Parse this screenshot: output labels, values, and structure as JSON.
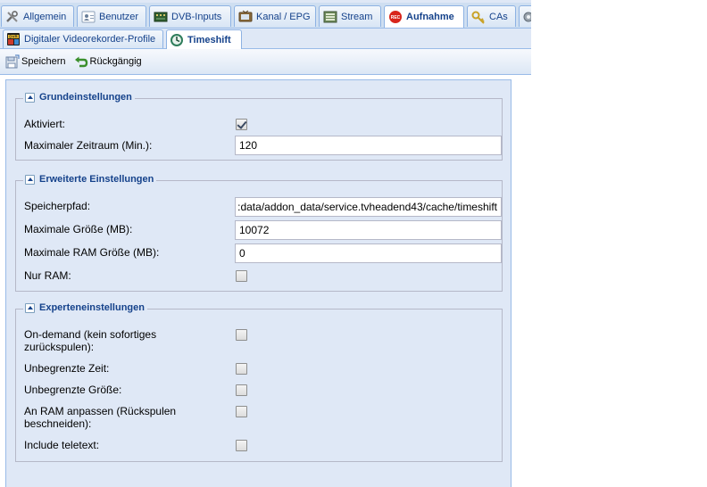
{
  "tabs": [
    {
      "label": "Allgemein",
      "icon": "wrench-icon"
    },
    {
      "label": "Benutzer",
      "icon": "user-icon"
    },
    {
      "label": "DVB-Inputs",
      "icon": "tuner-icon"
    },
    {
      "label": "Kanal / EPG",
      "icon": "tv-icon"
    },
    {
      "label": "Stream",
      "icon": "stream-icon"
    },
    {
      "label": "Aufnahme",
      "icon": "record-icon"
    },
    {
      "label": "CAs",
      "icon": "key-icon"
    }
  ],
  "subtabs": [
    {
      "label": "Digitaler Videorekorder-Profile",
      "icon": "dvr-icon"
    },
    {
      "label": "Timeshift",
      "icon": "timeshift-icon"
    }
  ],
  "toolbar": {
    "save_label": "Speichern",
    "undo_label": "Rückgängig"
  },
  "sections": {
    "basic": {
      "title": "Grundeinstellungen",
      "enabled_label": "Aktiviert:",
      "enabled": true,
      "max_period_label": "Maximaler Zeitraum (Min.):",
      "max_period_value": "120"
    },
    "advanced": {
      "title": "Erweiterte Einstellungen",
      "path_label": "Speicherpfad:",
      "path_value": ":data/addon_data/service.tvheadend43/cache/timeshift",
      "max_size_label": "Maximale Größe (MB):",
      "max_size_value": "10072",
      "max_ram_label": "Maximale RAM Größe (MB):",
      "max_ram_value": "0",
      "ram_only_label": "Nur RAM:",
      "ram_only": false
    },
    "expert": {
      "title": "Experteneinstellungen",
      "ondemand_label_1": "On-demand (kein sofortiges",
      "ondemand_label_2": "zurückspulen):",
      "unlimited_time_label": "Unbegrenzte Zeit:",
      "unlimited_size_label": "Unbegrenzte Größe:",
      "fit_ram_label_1": "An RAM anpassen (Rückspulen",
      "fit_ram_label_2": "beschneiden):",
      "teletext_label": "Include teletext:"
    }
  }
}
